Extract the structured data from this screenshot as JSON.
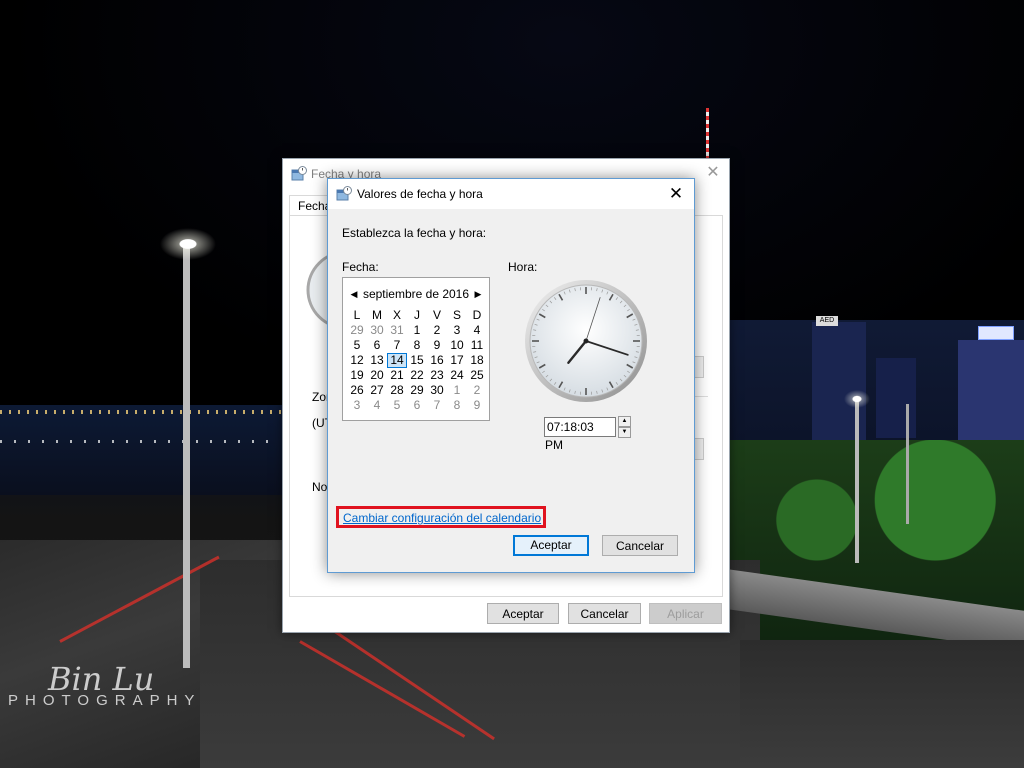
{
  "parent_dialog": {
    "title": "Fecha y hora",
    "tab_label": "Fecha",
    "fragment_zone": "Zor",
    "fragment_utc": "(UT",
    "fragment_no": "No",
    "ok_label": "Aceptar",
    "cancel_label": "Cancelar",
    "apply_label": "Aplicar"
  },
  "dialog": {
    "title": "Valores de fecha y hora",
    "instruction": "Establezca la fecha y hora:",
    "date_label": "Fecha:",
    "time_label": "Hora:",
    "calendar": {
      "month_label": "septiembre de 2016",
      "weekday_headers": [
        "L",
        "M",
        "X",
        "J",
        "V",
        "S",
        "D"
      ],
      "weeks": [
        [
          "29",
          "30",
          "31",
          "1",
          "2",
          "3",
          "4"
        ],
        [
          "5",
          "6",
          "7",
          "8",
          "9",
          "10",
          "11"
        ],
        [
          "12",
          "13",
          "14",
          "15",
          "16",
          "17",
          "18"
        ],
        [
          "19",
          "20",
          "21",
          "22",
          "23",
          "24",
          "25"
        ],
        [
          "26",
          "27",
          "28",
          "29",
          "30",
          "1",
          "2"
        ],
        [
          "3",
          "4",
          "5",
          "6",
          "7",
          "8",
          "9"
        ]
      ],
      "selected_day": "14"
    },
    "clock": {
      "hour": 7,
      "minute": 18,
      "second": 3
    },
    "time_value": "07:18:03 PM",
    "calendar_settings_link": "Cambiar configuración del calendario",
    "ok_label": "Aceptar",
    "cancel_label": "Cancelar"
  },
  "wallpaper": {
    "sign_text": "AED",
    "watermark_signature": "Bin Lu",
    "watermark_text": "PHOTOGRAPHY"
  },
  "colors": {
    "accent": "#0078d7",
    "link": "#0066cc",
    "highlight_box": "#e0131f"
  }
}
